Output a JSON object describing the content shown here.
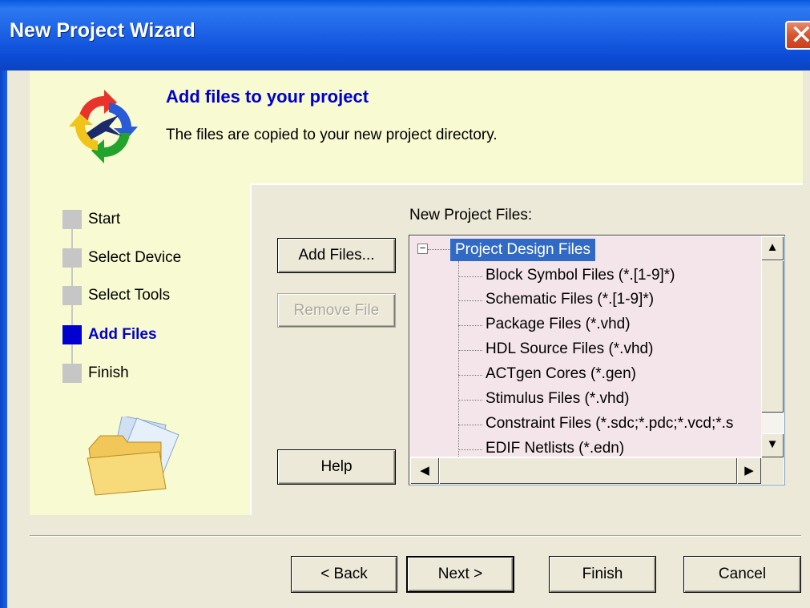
{
  "window": {
    "title": "New Project Wizard",
    "close_glyph": "✕"
  },
  "header": {
    "heading": "Add files to your project",
    "subtitle": "The files are copied to your new project directory."
  },
  "steps": [
    {
      "label": "Start",
      "active": false
    },
    {
      "label": "Select Device",
      "active": false
    },
    {
      "label": "Select Tools",
      "active": false
    },
    {
      "label": "Add Files",
      "active": true
    },
    {
      "label": "Finish",
      "active": false
    }
  ],
  "buttons": {
    "add_files": "Add Files...",
    "remove_file": "Remove File",
    "help": "Help",
    "back": "< Back",
    "next": "Next >",
    "finish": "Finish",
    "cancel": "Cancel"
  },
  "files": {
    "label": "New Project Files:",
    "expander": "−",
    "root": "Project Design Files",
    "children": [
      "Block Symbol Files (*.[1-9]*)",
      "Schematic Files (*.[1-9]*)",
      "Package Files (*.vhd)",
      "HDL Source Files (*.vhd)",
      "ACTgen Cores (*.gen)",
      "Stimulus Files (*.vhd)",
      "Constraint Files (*.sdc;*.pdc;*.vcd;*.s",
      "EDIF Netlists (*.edn)"
    ]
  },
  "scrollbars": {
    "up": "▲",
    "down": "▼",
    "left": "◀",
    "right": "▶"
  },
  "icons": {
    "wizard_logo": "wizard-logo-icon",
    "folder": "folder-icon"
  },
  "colors": {
    "title_bar": "#1d63e6",
    "panel_yellow": "#f8fad2",
    "heading_blue": "#0000cc",
    "selection": "#316ac5",
    "tree_background": "#f3e5ea"
  }
}
